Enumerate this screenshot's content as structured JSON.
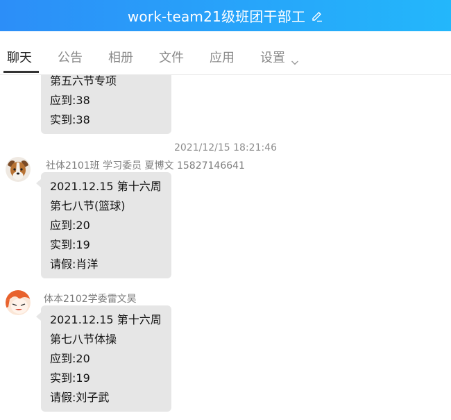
{
  "window": {
    "title": "work-team21级班团干部工",
    "colors": {
      "title_gradient_start": "#2c8ef8",
      "title_gradient_end": "#23b7fb"
    }
  },
  "tabs": [
    {
      "label": "聊天",
      "active": true
    },
    {
      "label": "公告"
    },
    {
      "label": "相册"
    },
    {
      "label": "文件"
    },
    {
      "label": "应用"
    },
    {
      "label": "设置"
    }
  ],
  "chat": {
    "top_partial": {
      "lines": [
        "第五六节专项",
        "应到:38",
        "实到:38"
      ]
    },
    "timestamp": "2021/12/15 18:21:46",
    "messages": [
      {
        "sender": "社体2101班 学习委员 夏博文 15827146641",
        "avatar": "dog-avatar",
        "lines": [
          "2021.12.15 第十六周",
          "第七八节(篮球)",
          "应到:20",
          "实到:19",
          "请假:肖洋"
        ]
      },
      {
        "sender": "体本2102学委雷文昊",
        "avatar": "anime-avatar",
        "lines": [
          "2021.12.15 第十六周",
          "第七八节体操",
          "应到:20",
          "实到:19",
          "请假:刘子武"
        ]
      }
    ]
  }
}
